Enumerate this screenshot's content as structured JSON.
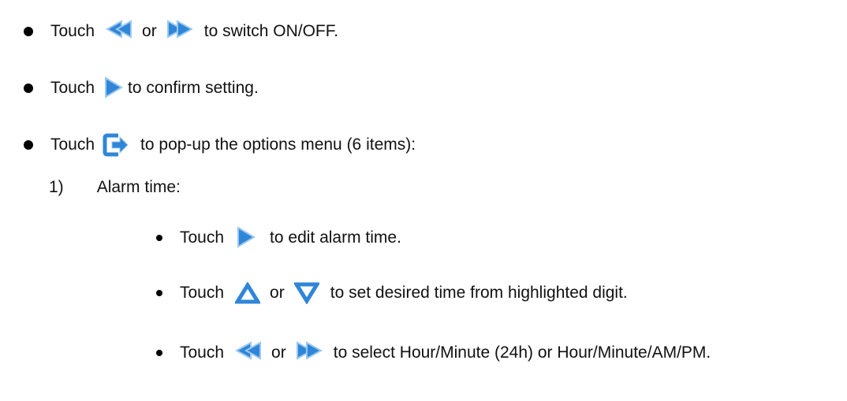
{
  "lines": [
    {
      "touch": "Touch",
      "or": "or",
      "tail": "to switch ON/OFF."
    },
    {
      "touch": "Touch",
      "tail": "to confirm setting."
    },
    {
      "touch": "Touch",
      "tail": "to pop-up the options menu (6 items):"
    },
    {
      "num": "1)",
      "label": "Alarm time:"
    },
    {
      "touch": "Touch",
      "tail": "to edit alarm time."
    },
    {
      "touch": "Touch",
      "or": "or",
      "tail": "to set desired time from highlighted digit."
    },
    {
      "touch": "Touch",
      "or": "or",
      "tail": "to select Hour/Minute (24h) or Hour/Minute/AM/PM."
    }
  ],
  "icons": {
    "rewind": "rewind-icon",
    "fast_forward": "fast-forward-icon",
    "play": "play-icon",
    "exit": "exit-icon",
    "up": "up-triangle-icon",
    "down": "down-triangle-icon"
  },
  "colors": {
    "icon_blue": "#2f86d8",
    "icon_border": "#9cc8f0"
  }
}
